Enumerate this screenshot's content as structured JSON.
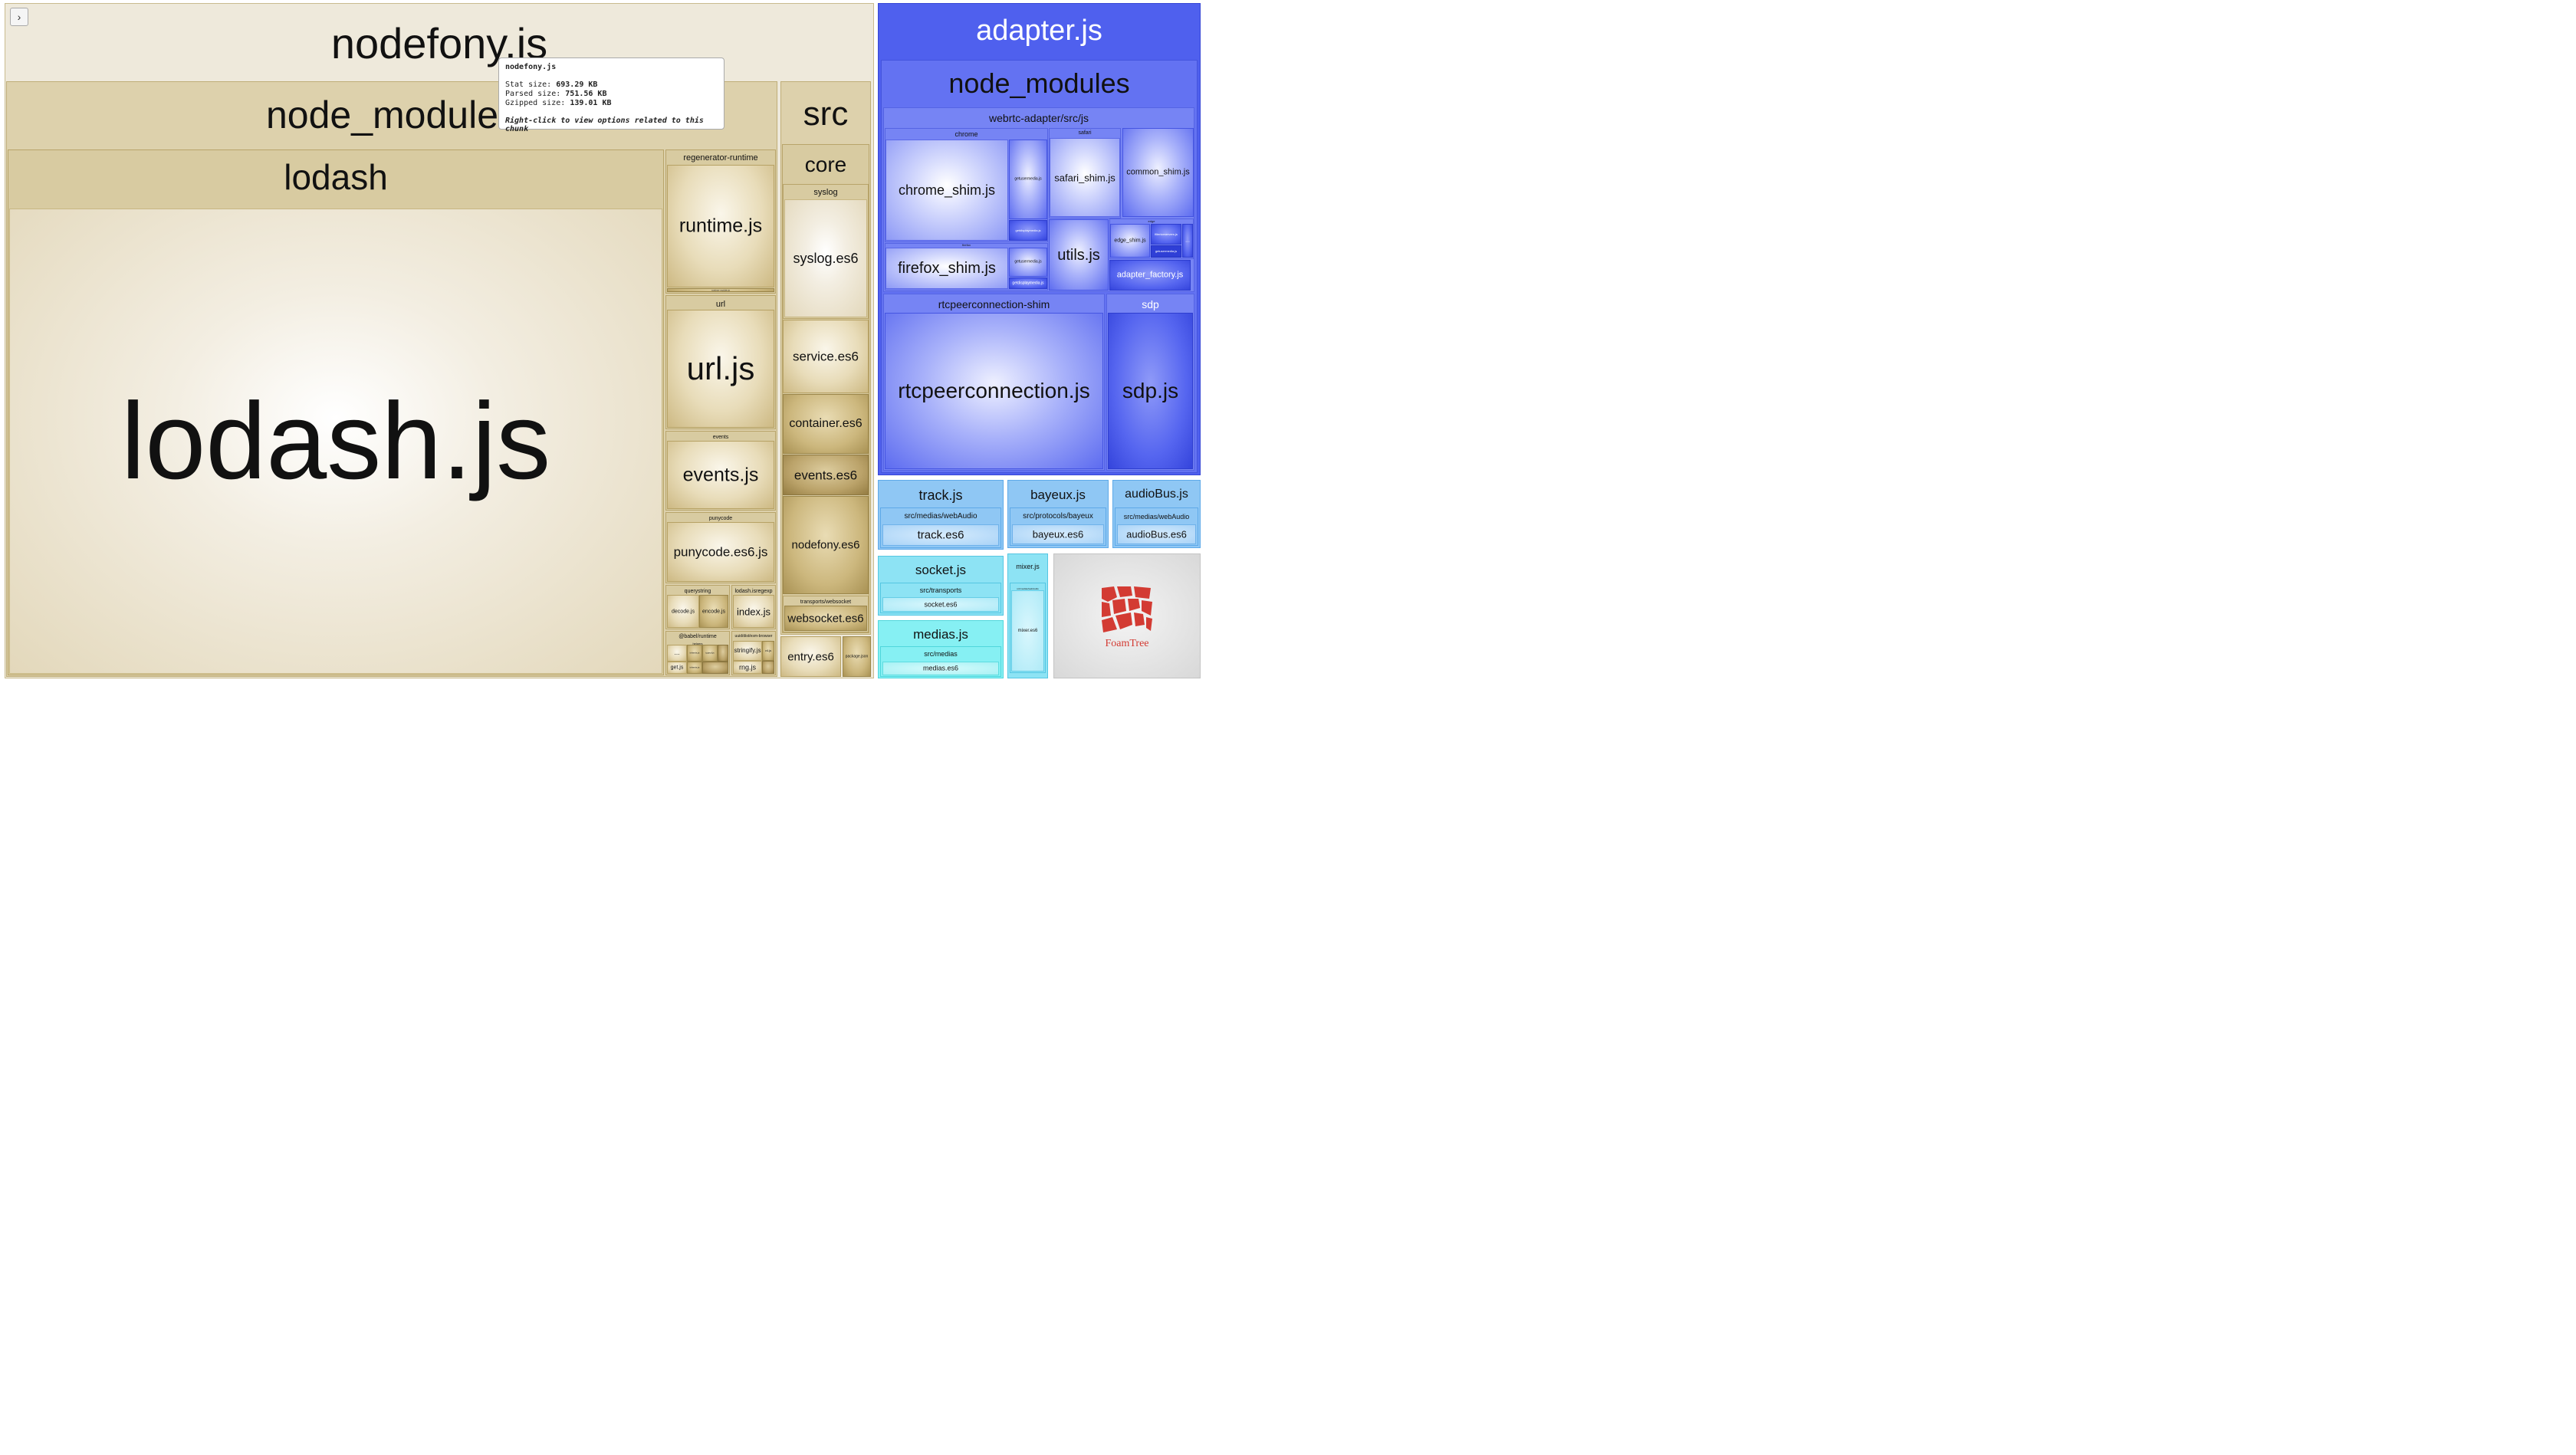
{
  "sidebar_toggle": {
    "icon": "chevron-right-icon",
    "glyph": "›"
  },
  "tooltip": {
    "title": "nodefony.js",
    "stat_label": "Stat size:",
    "stat_value": "693.29 KB",
    "parsed_label": "Parsed size:",
    "parsed_value": "751.56 KB",
    "gzip_label": "Gzipped size:",
    "gzip_value": "139.01 KB",
    "hint": "Right-click to view options related to this chunk"
  },
  "nodefony": {
    "title": "nodefony.js",
    "node_modules": {
      "title": "node_modules",
      "lodash": {
        "title": "lodash",
        "file": "lodash.js"
      },
      "regenerator_runtime": {
        "title": "regenerator-runtime",
        "file": "runtime.js",
        "tiny": "runtime-module.js"
      },
      "url": {
        "title": "url",
        "file": "url.js"
      },
      "events": {
        "title": "events",
        "file": "events.js"
      },
      "punycode": {
        "title": "punycode",
        "file": "punycode.es6.js"
      },
      "querystring": {
        "title": "querystring",
        "decode": "decode.js",
        "encode": "encode.js"
      },
      "lodash_isregexp": {
        "title": "lodash.isregexp",
        "file": "index.js"
      },
      "babel_runtime": {
        "title": "@babel/runtime",
        "sub": "helpers",
        "file": "get.js",
        "file2": "inherits.js",
        "file3": "typeof.js",
        "dots": "..."
      },
      "uuid": {
        "title": "uuid/dist/esm-browser",
        "stringify": "stringify.js",
        "rng": "rng.js",
        "v4": "v4.js"
      }
    },
    "src": {
      "title": "src",
      "core": {
        "title": "core",
        "syslog": {
          "title": "syslog",
          "file": "syslog.es6"
        },
        "service": "service.es6",
        "container": "container.es6",
        "events": "events.es6",
        "nodefony": "nodefony.es6",
        "transports": {
          "title": "transports/websocket",
          "file": "websocket.es6"
        }
      },
      "entry": "entry.es6",
      "package": "package.json"
    }
  },
  "adapter": {
    "title": "adapter.js",
    "node_modules": {
      "title": "node_modules",
      "webrtc": {
        "title": "webrtc-adapter/src/js",
        "chrome": {
          "title": "chrome",
          "file": "chrome_shim.js",
          "getusermedia": "getusermedia.js",
          "getdisplaymedia": "getdisplaymedia.js"
        },
        "safari": {
          "title": "safari",
          "file": "safari_shim.js"
        },
        "common": "common_shim.js",
        "firefox": {
          "title": "firefox",
          "file": "firefox_shim.js",
          "getusermedia": "getusermedia.js",
          "getdisplaymedia": "getdisplaymedia.js"
        },
        "utils": "utils.js",
        "edge": {
          "title": "edge",
          "file": "edge_shim.js",
          "filtericeservers": "filtericeservers.js",
          "getusermedia": "getusermedia.js",
          "dots": "..."
        },
        "factory": "adapter_factory.js"
      },
      "rtc": {
        "title": "rtcpeerconnection-shim",
        "file": "rtcpeerconnection.js"
      },
      "sdp": {
        "title": "sdp",
        "file": "sdp.js"
      }
    }
  },
  "track": {
    "title": "track.js",
    "path": "src/medias/webAudio",
    "file": "track.es6"
  },
  "bayeux": {
    "title": "bayeux.js",
    "path": "src/protocols/bayeux",
    "file": "bayeux.es6"
  },
  "audiobus": {
    "title": "audioBus.js",
    "path": "src/medias/webAudio",
    "file": "audioBus.es6"
  },
  "socket": {
    "title": "socket.js",
    "path": "src/transports",
    "file": "socket.es6"
  },
  "mixer": {
    "title": "mixer.js",
    "path": "src/medias/webAudio",
    "file": "mixer.es6"
  },
  "medias": {
    "title": "medias.js",
    "path": "src/medias",
    "file": "medias.es6"
  },
  "foamtree": {
    "text": "FoamTree"
  },
  "colors": {
    "gold": "#d8cba1",
    "blue": "#4f60ee",
    "lightblue": "#8fc7f4",
    "cyan": "#86f0f3"
  }
}
